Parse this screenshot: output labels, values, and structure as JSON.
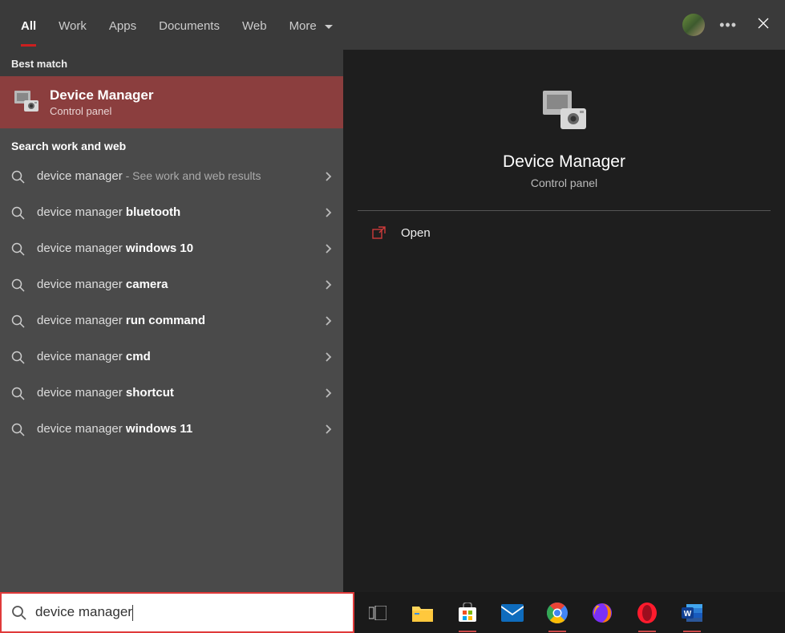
{
  "tabs": {
    "all": "All",
    "work": "Work",
    "apps": "Apps",
    "documents": "Documents",
    "web": "Web",
    "more": "More"
  },
  "sections": {
    "best_match": "Best match",
    "search_work_web": "Search work and web"
  },
  "best_match": {
    "title": "Device Manager",
    "subtitle": "Control panel"
  },
  "results": [
    {
      "prefix": "device manager",
      "bold": "",
      "suffix": " - See work and web results"
    },
    {
      "prefix": "device manager ",
      "bold": "bluetooth",
      "suffix": ""
    },
    {
      "prefix": "device manager ",
      "bold": "windows 10",
      "suffix": ""
    },
    {
      "prefix": "device manager ",
      "bold": "camera",
      "suffix": ""
    },
    {
      "prefix": "device manager ",
      "bold": "run command",
      "suffix": ""
    },
    {
      "prefix": "device manager ",
      "bold": "cmd",
      "suffix": ""
    },
    {
      "prefix": "device manager ",
      "bold": "shortcut",
      "suffix": ""
    },
    {
      "prefix": "device manager ",
      "bold": "windows 11",
      "suffix": ""
    }
  ],
  "preview": {
    "title": "Device Manager",
    "subtitle": "Control panel",
    "open": "Open"
  },
  "search": {
    "query": "device manager"
  },
  "taskbar_icons": [
    "taskview",
    "file-explorer",
    "store",
    "mail",
    "chrome",
    "firefox",
    "opera",
    "word"
  ]
}
